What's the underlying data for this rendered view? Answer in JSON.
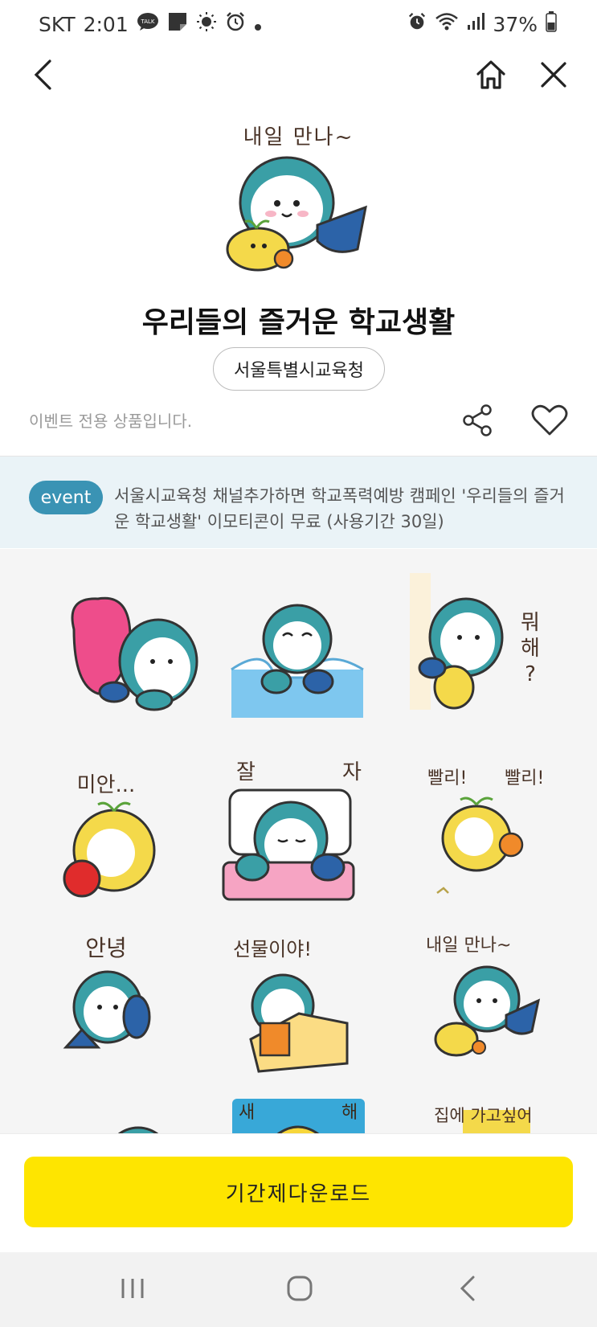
{
  "status": {
    "carrier": "SKT",
    "time": "2:01",
    "battery": "37%"
  },
  "nav": {
    "back_icon": "chevron-left-icon",
    "home_icon": "home-icon",
    "close_icon": "close-icon"
  },
  "product": {
    "hero_caption": "내일 만나~",
    "title": "우리들의 즐거운 학교생활",
    "author": "서울특별시교육청",
    "notice": "이벤트 전용 상품입니다."
  },
  "event": {
    "badge": "event",
    "text": "서울시교육청 채널추가하면 학교폭력예방 캠페인 '우리들의 즐거운 학교생활' 이모티콘이 무료 (사용기간 30일)"
  },
  "stickers": [
    {
      "caption": ""
    },
    {
      "caption": ""
    },
    {
      "caption": "뭐 해 ?"
    },
    {
      "caption": "미안..."
    },
    {
      "caption": "잘 자"
    },
    {
      "caption": "빨리! 빨리!"
    },
    {
      "caption": "안녕"
    },
    {
      "caption": "선물이야!"
    },
    {
      "caption": "내일 만나~"
    },
    {
      "caption": ""
    },
    {
      "caption": "새 해"
    },
    {
      "caption": "집에 가고싶어"
    }
  ],
  "download": {
    "label": "기간제다운로드"
  },
  "colors": {
    "accent_yellow": "#fee500",
    "event_blue": "#3a93b4",
    "banner_bg": "#eaf3f7",
    "character_teal": "#3a9fa6"
  }
}
